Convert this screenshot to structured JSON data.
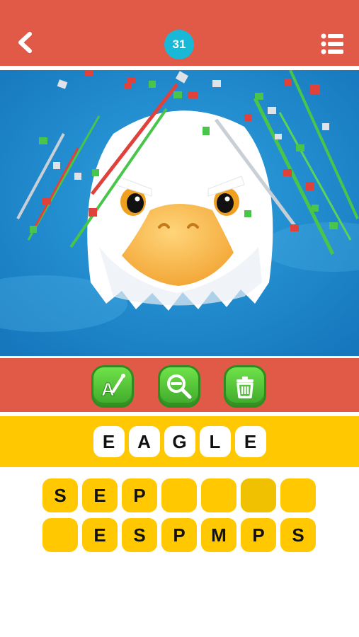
{
  "header": {
    "level": "31",
    "back_icon": "chevron-left-icon",
    "menu_icon": "list-icon"
  },
  "puzzle": {
    "subject_icon": "eagle-emoji-icon",
    "effect": "confetti-burst"
  },
  "tools": [
    {
      "name": "hint",
      "icon": "letter-hint-icon",
      "label": "A"
    },
    {
      "name": "zoom",
      "icon": "zoom-out-icon"
    },
    {
      "name": "remove",
      "icon": "trash-can-icon"
    }
  ],
  "answer": [
    "E",
    "A",
    "G",
    "L",
    "E"
  ],
  "keyboard_rows": [
    [
      "S",
      "E",
      "P",
      "",
      "",
      "",
      ""
    ],
    [
      "",
      "E",
      "S",
      "P",
      "M",
      "P",
      "S"
    ]
  ],
  "colors": {
    "header": "#e05a47",
    "accent": "#ffc800",
    "badge": "#19b8d6",
    "tool_green": "#4fc034",
    "sky": "#1f8fcf"
  }
}
